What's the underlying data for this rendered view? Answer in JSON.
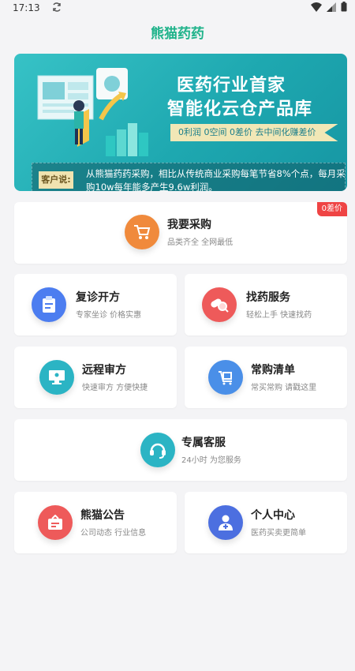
{
  "status": {
    "time": "17:13"
  },
  "app_title": "熊猫药药",
  "banner": {
    "headline1": "医药行业首家",
    "headline2": "智能化云仓产品库",
    "tagline": "0利润 0空间 0差价 去中间化赚差价",
    "quote_label": "客户说:",
    "quote_text": "从熊猫药药采购，相比从传统商业采购每笔节省8%个点，每月采购10w每年能多产生9.6w利润。"
  },
  "tiles": {
    "purchase": {
      "title": "我要采购",
      "sub": "品类齐全 全网最低",
      "badge": "0差价",
      "color": "#f08a3c",
      "icon": "cart-icon"
    },
    "followup": {
      "title": "复诊开方",
      "sub": "专家坐诊 价格实惠",
      "color": "#4c7df0",
      "icon": "prescription-icon"
    },
    "find_drug": {
      "title": "找药服务",
      "sub": "轻松上手 快速找药",
      "color": "#ee5a5a",
      "icon": "pill-search-icon"
    },
    "remote_review": {
      "title": "远程审方",
      "sub": "快速审方 方便快捷",
      "color": "#2bb4c4",
      "icon": "monitor-icon"
    },
    "frequent_list": {
      "title": "常购清单",
      "sub": "常买常购 请戳这里",
      "color": "#4a8fe8",
      "icon": "clipboard-cart-icon"
    },
    "customer_service": {
      "title": "专属客服",
      "sub": "24小时 为您服务",
      "color": "#2bb4c4",
      "icon": "headset-icon"
    },
    "announcement": {
      "title": "熊猫公告",
      "sub": "公司动态 行业信息",
      "color": "#ee5a5a",
      "icon": "notice-icon"
    },
    "profile": {
      "title": "个人中心",
      "sub": "医药买卖更简单",
      "color": "#4c6fe0",
      "icon": "doctor-icon"
    }
  }
}
